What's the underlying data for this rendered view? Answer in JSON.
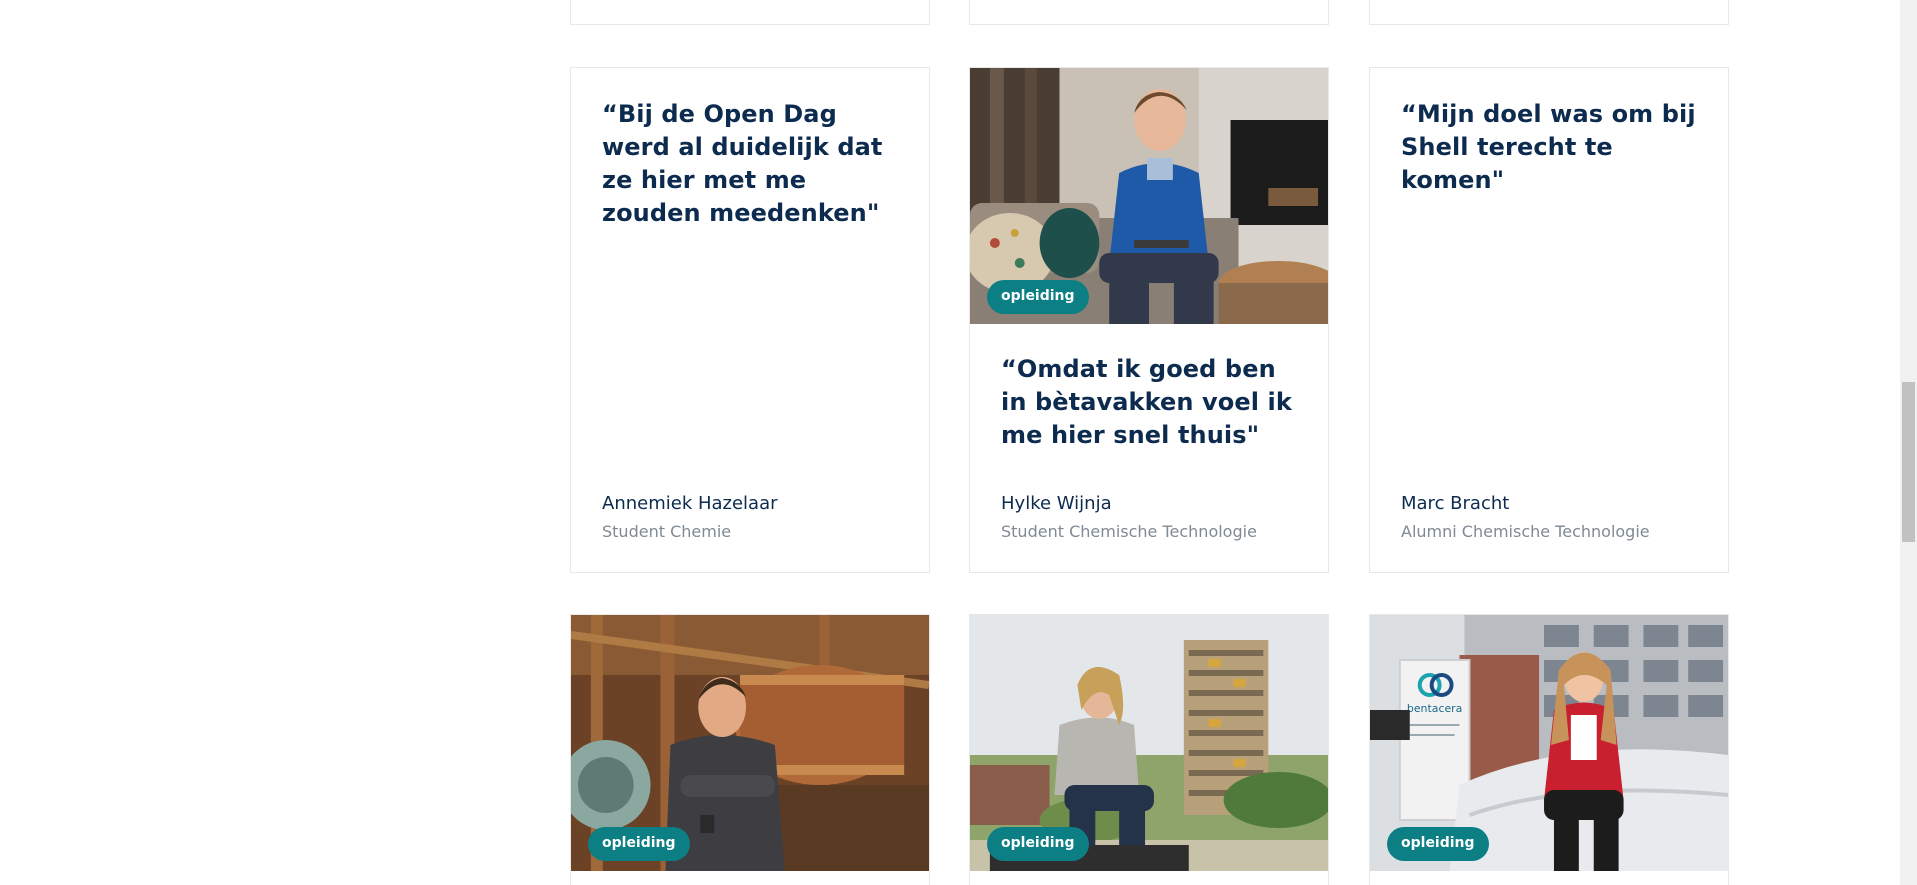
{
  "cards": {
    "annemiek": {
      "quote": "“Bij de Open Dag werd al duidelijk dat ze hier met me zouden meedenken\"",
      "name": "Annemiek Hazelaar",
      "role": "Student Chemie"
    },
    "hylke": {
      "tag": "opleiding",
      "quote": "“Omdat ik goed ben in bètavakken voel ik me hier snel thuis\"",
      "name": "Hylke Wijnja",
      "role": "Student Chemische Technologie"
    },
    "marc": {
      "quote": "“Mijn doel was om bij Shell terecht te komen\"",
      "name": "Marc Bracht",
      "role": "Alumni Chemische Technologie"
    },
    "row2": [
      {
        "tag": "opleiding"
      },
      {
        "tag": "opleiding"
      },
      {
        "tag": "opleiding",
        "sign_text": "bentacera"
      }
    ]
  },
  "colors": {
    "heading": "#0d2b4e",
    "muted": "#7f8a94",
    "tag_bg": "#0b7f83",
    "border": "#e8e8e8"
  }
}
